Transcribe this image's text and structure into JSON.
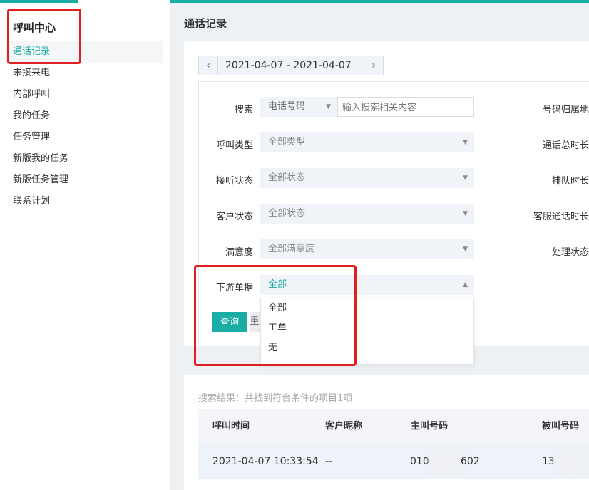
{
  "sidebar": {
    "title": "呼叫中心",
    "items": [
      {
        "label": "通话记录"
      },
      {
        "label": "未接来电"
      },
      {
        "label": "内部呼叫"
      },
      {
        "label": "我的任务"
      },
      {
        "label": "任务管理"
      },
      {
        "label": "新版我的任务"
      },
      {
        "label": "新版任务管理"
      },
      {
        "label": "联系计划"
      }
    ]
  },
  "main": {
    "title": "通话记录",
    "date_range": "2021-04-07 - 2021-04-07",
    "prev_icon": "chevron-left-icon",
    "next_icon": "chevron-right-icon"
  },
  "filters": {
    "search": {
      "label": "搜索",
      "type_value": "电话号码",
      "placeholder": "输入搜索相关内容"
    },
    "call_type": {
      "label": "呼叫类型",
      "value": "全部类型"
    },
    "answer_status": {
      "label": "接听状态",
      "value": "全部状态"
    },
    "customer_status": {
      "label": "客户状态",
      "value": "全部状态"
    },
    "satisfaction": {
      "label": "满意度",
      "value": "全部满意度"
    },
    "downstream": {
      "label": "下游单据",
      "value": "全部",
      "options": [
        "全部",
        "工单",
        "无"
      ]
    },
    "right_labels": [
      "号码归属地",
      "通话总时长",
      "排队时长",
      "客服通话时长",
      "处理状态"
    ]
  },
  "buttons": {
    "query": "查询",
    "reset": "重"
  },
  "results": {
    "summary": "搜索结果：共找到符合条件的项目1项",
    "columns": [
      "呼叫时间",
      "客户昵称",
      "主叫号码",
      "被叫号码"
    ],
    "rows": [
      {
        "time": "2021-04-07 10:33:54",
        "nickname": "--",
        "caller_prefix": "010",
        "caller_suffix": "602",
        "callee_prefix": "13"
      }
    ]
  },
  "colors": {
    "accent": "#1aada6",
    "highlight": "#e02020"
  }
}
